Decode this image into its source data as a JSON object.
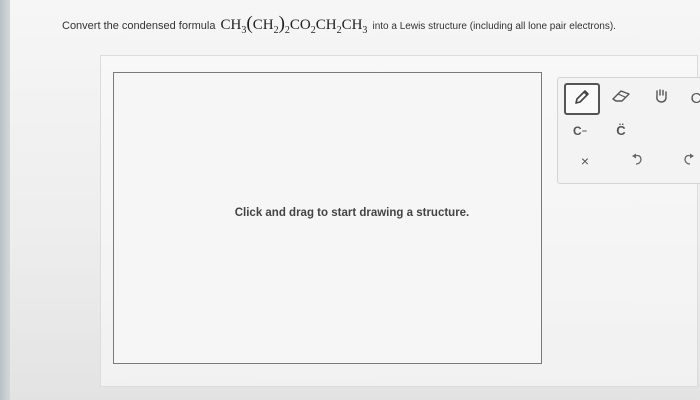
{
  "question": {
    "prefix": "Convert the condensed formula",
    "formula_ch": "CH",
    "formula_sub_3": "3",
    "formula_paren_open": "(",
    "formula_ch2": "CH",
    "formula_sub_2": "2",
    "formula_paren_close": ")",
    "formula_sub_outer_2": "2",
    "formula_co": "CO",
    "formula_sub_co_2": "2",
    "formula_ch_b": "CH",
    "formula_sub_b_2": "2",
    "formula_ch_c": "CH",
    "formula_sub_c_3": "3",
    "suffix": "into a Lewis structure (including all lone pair electrons)."
  },
  "canvas": {
    "hint": "Click and drag to start drawing a structure."
  },
  "palette": {
    "anion_label": "C",
    "anion_charge": "−",
    "lone_pair_label": "C̈",
    "close_label": "×",
    "extra_label": "C"
  },
  "colors": {
    "page_background": "#f2f2f2",
    "canvas_background": "#f6f6f6",
    "canvas_border": "#7a7a7a",
    "icon_color": "#555555"
  },
  "icons": {
    "pencil": "pencil-icon",
    "eraser": "eraser-icon",
    "hand": "hand-icon",
    "undo": "undo-icon",
    "redo": "redo-icon",
    "close": "close-icon"
  }
}
